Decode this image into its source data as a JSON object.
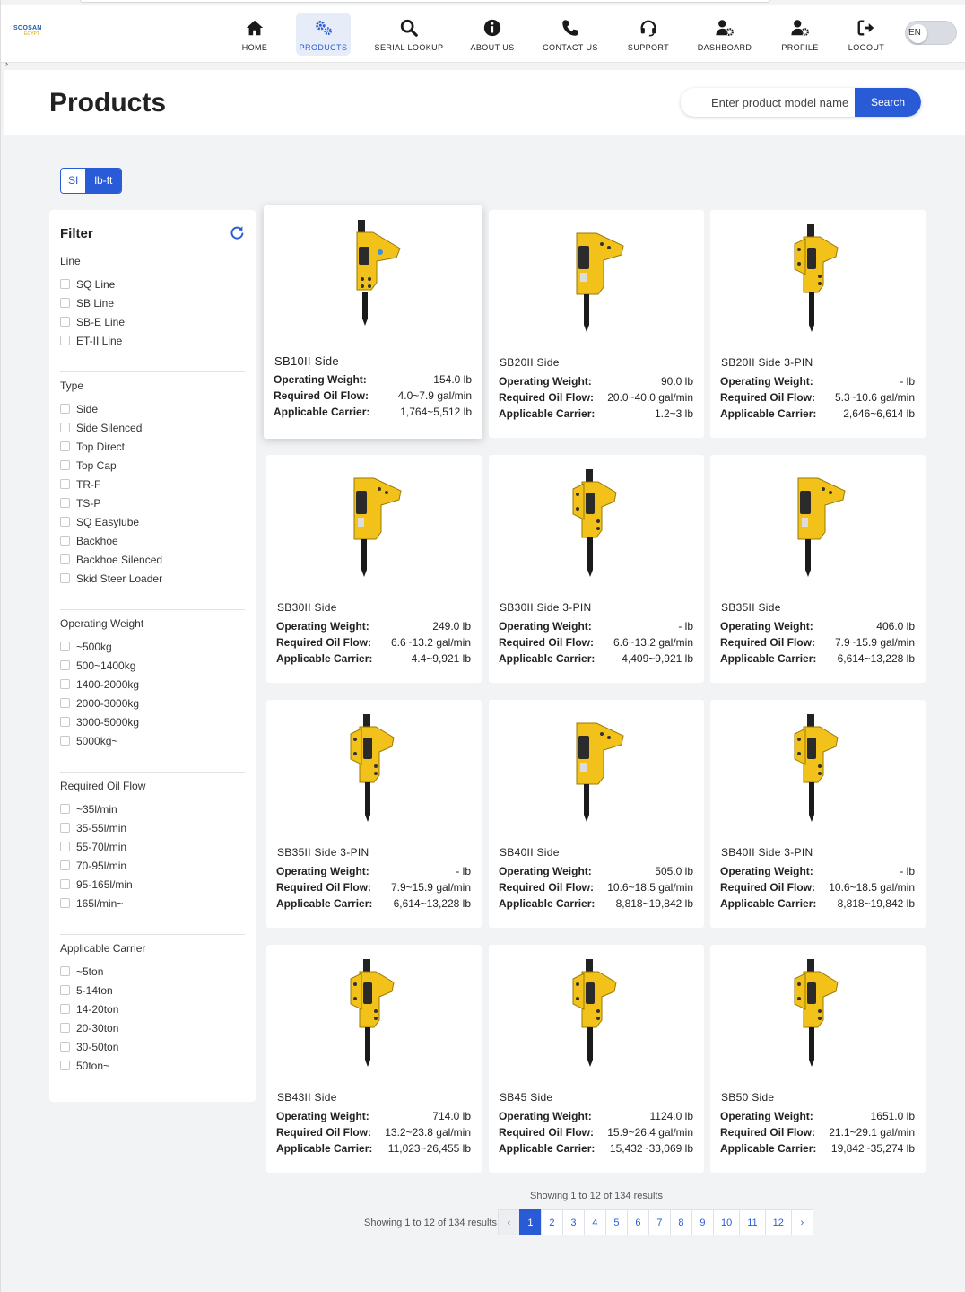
{
  "brand": {
    "logo_text": "SOOSAN",
    "logo_sub": "EGYPT"
  },
  "nav": [
    {
      "label": "HOME",
      "icon": "home-icon"
    },
    {
      "label": "PRODUCTS",
      "icon": "gears-icon"
    },
    {
      "label": "SERIAL LOOKUP",
      "icon": "search-icon"
    },
    {
      "label": "ABOUT US",
      "icon": "info-icon"
    },
    {
      "label": "CONTACT US",
      "icon": "phone-icon"
    },
    {
      "label": "SUPPORT",
      "icon": "headset-icon"
    },
    {
      "label": "DASHBOARD",
      "icon": "user-gear-icon"
    },
    {
      "label": "PROFILE",
      "icon": "user-gear-icon"
    },
    {
      "label": "LOGOUT",
      "icon": "logout-icon"
    }
  ],
  "language_toggle": {
    "label": "EN"
  },
  "page": {
    "title": "Products"
  },
  "search": {
    "placeholder": "Enter product model name",
    "button": "Search"
  },
  "units": {
    "si": "SI",
    "imperial": "lb-ft"
  },
  "filter": {
    "title": "Filter",
    "groups": [
      {
        "title": "Line",
        "options": [
          "SQ Line",
          "SB Line",
          "SB-E Line",
          "ET-II Line"
        ]
      },
      {
        "title": "Type",
        "options": [
          "Side",
          "Side Silenced",
          "Top Direct",
          "Top Cap",
          "TR-F",
          "TS-P",
          "SQ Easylube",
          "Backhoe",
          "Backhoe Silenced",
          "Skid Steer Loader"
        ]
      },
      {
        "title": "Operating Weight",
        "options": [
          "~500kg",
          "500~1400kg",
          "1400-2000kg",
          "2000-3000kg",
          "3000-5000kg",
          "5000kg~"
        ]
      },
      {
        "title": "Required Oil Flow",
        "options": [
          "~35l/min",
          "35-55l/min",
          "55-70l/min",
          "70-95l/min",
          "95-165l/min",
          "165l/min~"
        ]
      },
      {
        "title": "Applicable Carrier",
        "options": [
          "~5ton",
          "5-14ton",
          "14-20ton",
          "20-30ton",
          "30-50ton",
          "50ton~"
        ]
      }
    ]
  },
  "spec_labels": {
    "weight": "Operating Weight:",
    "oil": "Required Oil Flow:",
    "carrier": "Applicable Carrier:"
  },
  "products": [
    {
      "name": "SB10II Side",
      "weight": "154.0 lb",
      "oil": "4.0~7.9 gal/min",
      "carrier": "1,764~5,512 lb"
    },
    {
      "name": "SB20II Side",
      "weight": "90.0 lb",
      "oil": "20.0~40.0 gal/min",
      "carrier": "1.2~3 lb"
    },
    {
      "name": "SB20II Side 3-PIN",
      "weight": "- lb",
      "oil": "5.3~10.6 gal/min",
      "carrier": "2,646~6,614 lb"
    },
    {
      "name": "SB30II Side",
      "weight": "249.0 lb",
      "oil": "6.6~13.2 gal/min",
      "carrier": "4.4~9,921 lb"
    },
    {
      "name": "SB30II Side 3-PIN",
      "weight": "- lb",
      "oil": "6.6~13.2 gal/min",
      "carrier": "4,409~9,921 lb"
    },
    {
      "name": "SB35II Side",
      "weight": "406.0 lb",
      "oil": "7.9~15.9 gal/min",
      "carrier": "6,614~13,228 lb"
    },
    {
      "name": "SB35II Side 3-PIN",
      "weight": "- lb",
      "oil": "7.9~15.9 gal/min",
      "carrier": "6,614~13,228 lb"
    },
    {
      "name": "SB40II Side",
      "weight": "505.0 lb",
      "oil": "10.6~18.5 gal/min",
      "carrier": "8,818~19,842 lb"
    },
    {
      "name": "SB40II Side 3-PIN",
      "weight": "- lb",
      "oil": "10.6~18.5 gal/min",
      "carrier": "8,818~19,842 lb"
    },
    {
      "name": "SB43II Side",
      "weight": "714.0 lb",
      "oil": "13.2~23.8 gal/min",
      "carrier": "11,023~26,455 lb"
    },
    {
      "name": "SB45 Side",
      "weight": "1124.0 lb",
      "oil": "15.9~26.4 gal/min",
      "carrier": "15,432~33,069 lb"
    },
    {
      "name": "SB50 Side",
      "weight": "1651.0 lb",
      "oil": "21.1~29.1 gal/min",
      "carrier": "19,842~35,274 lb"
    }
  ],
  "pagination": {
    "summary": "Showing 1 to 12 of 134 results",
    "prev": "‹",
    "next": "›",
    "pages": [
      "1",
      "2",
      "3",
      "4",
      "5",
      "6",
      "7",
      "8",
      "9",
      "10",
      "11",
      "12"
    ],
    "current": "1"
  },
  "colors": {
    "accent": "#2a5bd7",
    "product_yellow": "#f2c21b"
  }
}
